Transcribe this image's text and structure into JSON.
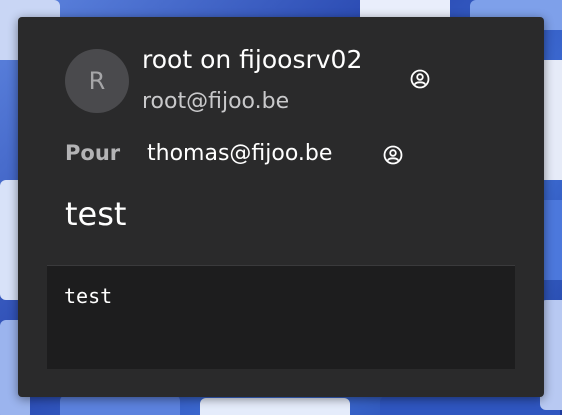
{
  "message": {
    "avatar_initial": "R",
    "sender_name": "root on fijoosrv02",
    "sender_email": "root@fijoo.be",
    "to_label": "Pour",
    "to_address": "thomas@fijoo.be",
    "subject": "test",
    "body": "test"
  },
  "icons": {
    "sender_contact": "contact-icon",
    "recipient_contact": "contact-icon"
  },
  "colors": {
    "popup_background": "#2a2a2b",
    "body_background": "#1d1d1e",
    "avatar_background": "#4a4a4d",
    "label_color": "#b3b3b5"
  }
}
